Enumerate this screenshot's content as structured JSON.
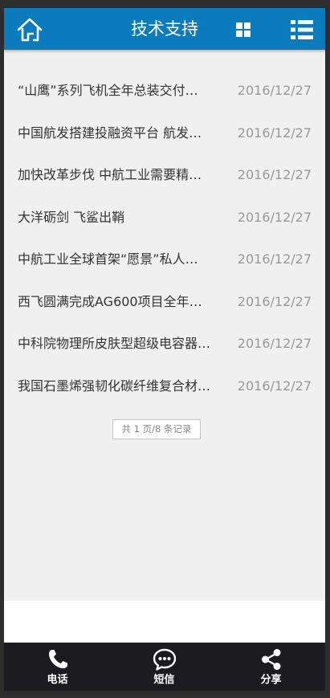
{
  "header": {
    "title": "技术支持",
    "left_icon": "home-icon",
    "right_icons": [
      "grid-icon",
      "list-menu-icon"
    ]
  },
  "news": [
    {
      "title": "“山鹰”系列飞机全年总装交付…",
      "date": "2016/12/27"
    },
    {
      "title": "中国航发搭建投融资平台 航发…",
      "date": "2016/12/27"
    },
    {
      "title": "加快改革步伐 中航工业需要精…",
      "date": "2016/12/27"
    },
    {
      "title": "大洋砺剑 飞鲨出鞘",
      "date": "2016/12/27"
    },
    {
      "title": "中航工业全球首架“愿景”私人…",
      "date": "2016/12/27"
    },
    {
      "title": "西飞圆满完成AG600项目全年…",
      "date": "2016/12/27"
    },
    {
      "title": "中科院物理所皮肤型超级电容器…",
      "date": "2016/12/27"
    },
    {
      "title": "我国石墨烯强韧化碳纤维复合材…",
      "date": "2016/12/27"
    }
  ],
  "pager": {
    "text": "共 1 页/8 条记录"
  },
  "footer": {
    "phone_label": "电话",
    "sms_label": "短信",
    "share_label": "分享"
  },
  "colors": {
    "header": "#0a7cbd",
    "footer": "#1c1c20",
    "background": "#f0f0f1"
  }
}
